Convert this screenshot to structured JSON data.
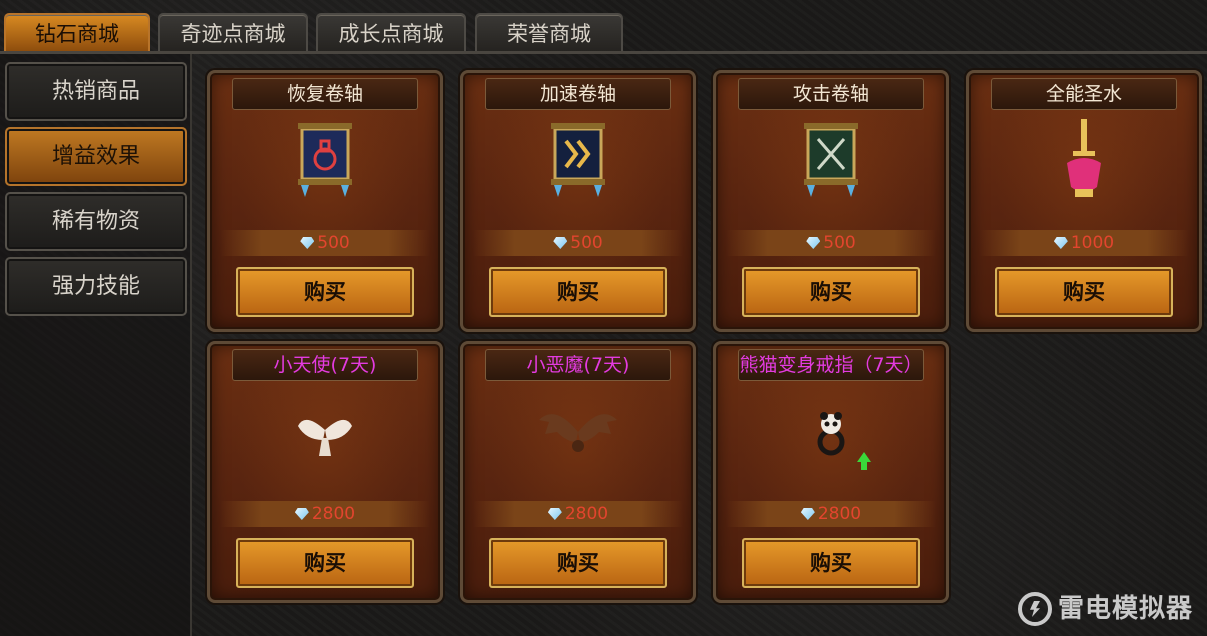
{
  "tabs": [
    {
      "label": "钻石商城",
      "active": true
    },
    {
      "label": "奇迹点商城",
      "active": false
    },
    {
      "label": "成长点商城",
      "active": false
    },
    {
      "label": "荣誉商城",
      "active": false
    }
  ],
  "categories": [
    {
      "label": "热销商品",
      "active": false
    },
    {
      "label": "增益效果",
      "active": true
    },
    {
      "label": "稀有物资",
      "active": false
    },
    {
      "label": "强力技能",
      "active": false
    }
  ],
  "items": [
    {
      "name": "恢复卷轴",
      "price": "500",
      "buy_label": "购买",
      "icon": "potion-scroll-icon",
      "name_color": "#f3e7d4"
    },
    {
      "name": "加速卷轴",
      "price": "500",
      "buy_label": "购买",
      "icon": "speed-scroll-icon",
      "name_color": "#f3e7d4"
    },
    {
      "name": "攻击卷轴",
      "price": "500",
      "buy_label": "购买",
      "icon": "attack-scroll-icon",
      "name_color": "#f3e7d4"
    },
    {
      "name": "全能圣水",
      "price": "1000",
      "buy_label": "购买",
      "icon": "holy-water-icon",
      "name_color": "#f3e7d4"
    },
    {
      "name": "小天使(7天)",
      "price": "2800",
      "buy_label": "购买",
      "icon": "angel-wings-icon",
      "name_color": "#e33be0"
    },
    {
      "name": "小恶魔(7天)",
      "price": "2800",
      "buy_label": "购买",
      "icon": "demon-wings-icon",
      "name_color": "#e33be0"
    },
    {
      "name": "熊猫变身戒指（7天）",
      "price": "2800",
      "buy_label": "购买",
      "icon": "panda-ring-icon",
      "name_color": "#e33be0"
    }
  ],
  "watermark": "雷电模拟器"
}
